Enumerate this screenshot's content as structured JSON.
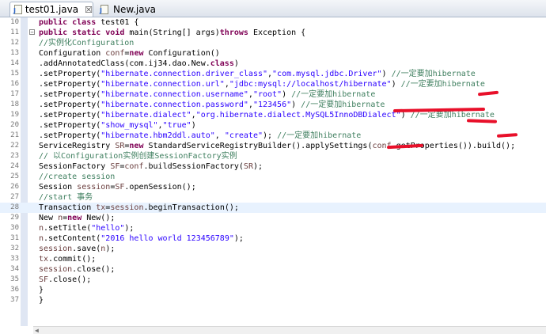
{
  "tabs": [
    {
      "label": "test01.java",
      "close": "☒",
      "active": true
    },
    {
      "label": "New.java",
      "active": false
    }
  ],
  "lines": [
    {
      "num": "10",
      "hl": false,
      "fold": "",
      "segs": [
        [
          "k",
          "public class "
        ],
        [
          "",
          "test01 {"
        ]
      ]
    },
    {
      "num": "11",
      "hl": false,
      "fold": "⊖",
      "segs": [
        [
          "k",
          "public static void "
        ],
        [
          "",
          "main(String[] args)"
        ],
        [
          "k",
          "throws "
        ],
        [
          "",
          "Exception {"
        ]
      ]
    },
    {
      "num": "12",
      "hl": false,
      "fold": "",
      "segs": [
        [
          "c",
          "//实例化Configuration"
        ]
      ]
    },
    {
      "num": "13",
      "hl": false,
      "fold": "",
      "segs": [
        [
          "",
          "Configuration "
        ],
        [
          "v",
          "conf"
        ],
        [
          "",
          "="
        ],
        [
          "k",
          "new "
        ],
        [
          "",
          "Configuration()"
        ]
      ]
    },
    {
      "num": "14",
      "hl": false,
      "fold": "",
      "segs": [
        [
          "",
          ".addAnnotatedClass(com.ij34.dao.New."
        ],
        [
          "k",
          "class"
        ],
        [
          "",
          ")"
        ]
      ]
    },
    {
      "num": "15",
      "hl": false,
      "fold": "",
      "segs": [
        [
          "",
          ".setProperty("
        ],
        [
          "s",
          "\"hibernate.connection.driver_class\""
        ],
        [
          "",
          ","
        ],
        [
          "s",
          "\"com.mysql.jdbc.Driver\""
        ],
        [
          "",
          ") "
        ],
        [
          "c",
          "//一定要加hibernate"
        ]
      ]
    },
    {
      "num": "16",
      "hl": false,
      "fold": "",
      "segs": [
        [
          "",
          ".setProperty("
        ],
        [
          "s",
          "\"hibernate.connection.url\""
        ],
        [
          "",
          ","
        ],
        [
          "s",
          "\"jdbc:mysql://localhost/hibernate\""
        ],
        [
          "",
          ") "
        ],
        [
          "c",
          "//一定要加hibernate"
        ]
      ]
    },
    {
      "num": "17",
      "hl": false,
      "fold": "",
      "segs": [
        [
          "",
          ".setProperty("
        ],
        [
          "s",
          "\"hibernate.connection.username\""
        ],
        [
          "",
          ","
        ],
        [
          "s",
          "\"root\""
        ],
        [
          "",
          ") "
        ],
        [
          "c",
          "//一定要加hibernate"
        ]
      ]
    },
    {
      "num": "18",
      "hl": false,
      "fold": "",
      "segs": [
        [
          "",
          ".setProperty("
        ],
        [
          "s",
          "\"hibernate.connection.password\""
        ],
        [
          "",
          ","
        ],
        [
          "s",
          "\"123456\""
        ],
        [
          "",
          ") "
        ],
        [
          "c",
          "//一定要加hibernate"
        ]
      ]
    },
    {
      "num": "19",
      "hl": false,
      "fold": "",
      "segs": [
        [
          "",
          ".setProperty("
        ],
        [
          "s",
          "\"hibernate.dialect\""
        ],
        [
          "",
          ","
        ],
        [
          "s",
          "\"org.hibernate.dialect.MySQL5InnoDBDialect\""
        ],
        [
          "",
          ") "
        ],
        [
          "c",
          "//一定要加hibernate"
        ]
      ]
    },
    {
      "num": "20",
      "hl": false,
      "fold": "",
      "segs": [
        [
          "",
          ".setProperty("
        ],
        [
          "s",
          "\"show_mysql\""
        ],
        [
          "",
          ","
        ],
        [
          "s",
          "\"true\""
        ],
        [
          "",
          ")"
        ]
      ]
    },
    {
      "num": "21",
      "hl": false,
      "fold": "",
      "segs": [
        [
          "",
          ".setProperty("
        ],
        [
          "s",
          "\"hibernate.hbm2ddl.auto\""
        ],
        [
          "",
          ", "
        ],
        [
          "s",
          "\"create\""
        ],
        [
          "",
          "); "
        ],
        [
          "c",
          "//一定要加hibernate"
        ]
      ]
    },
    {
      "num": "22",
      "hl": false,
      "fold": "",
      "segs": [
        [
          "",
          "ServiceRegistry "
        ],
        [
          "v",
          "SR"
        ],
        [
          "",
          "="
        ],
        [
          "k",
          "new "
        ],
        [
          "",
          "StandardServiceRegistryBuilder().applySettings("
        ],
        [
          "v",
          "conf"
        ],
        [
          "",
          ".getProperties()).build();"
        ]
      ]
    },
    {
      "num": "23",
      "hl": false,
      "fold": "",
      "segs": [
        [
          "c",
          "// 以Configuration实例创建SessionFactory实例"
        ]
      ]
    },
    {
      "num": "24",
      "hl": false,
      "fold": "",
      "segs": [
        [
          "",
          "SessionFactory "
        ],
        [
          "v",
          "SF"
        ],
        [
          "",
          "="
        ],
        [
          "v",
          "conf"
        ],
        [
          "",
          ".buildSessionFactory("
        ],
        [
          "v",
          "SR"
        ],
        [
          "",
          ");"
        ]
      ]
    },
    {
      "num": "25",
      "hl": false,
      "fold": "",
      "segs": [
        [
          "c",
          "//create session"
        ]
      ]
    },
    {
      "num": "26",
      "hl": false,
      "fold": "",
      "segs": [
        [
          "",
          "Session "
        ],
        [
          "v",
          "session"
        ],
        [
          "",
          "="
        ],
        [
          "v",
          "SF"
        ],
        [
          "",
          ".openSession();"
        ]
      ]
    },
    {
      "num": "27",
      "hl": false,
      "fold": "",
      "segs": [
        [
          "c",
          "//start 事务"
        ]
      ]
    },
    {
      "num": "28",
      "hl": true,
      "fold": "",
      "segs": [
        [
          "",
          "Transaction "
        ],
        [
          "v",
          "tx"
        ],
        [
          "",
          "="
        ],
        [
          "v",
          "session"
        ],
        [
          "",
          ".beginTransaction();"
        ]
      ]
    },
    {
      "num": "29",
      "hl": false,
      "fold": "",
      "segs": [
        [
          "",
          "New "
        ],
        [
          "v",
          "n"
        ],
        [
          "",
          "="
        ],
        [
          "k",
          "new "
        ],
        [
          "",
          "New();"
        ]
      ]
    },
    {
      "num": "30",
      "hl": false,
      "fold": "",
      "segs": [
        [
          "v",
          "n"
        ],
        [
          "",
          ".setTitle("
        ],
        [
          "s",
          "\"hello\""
        ],
        [
          "",
          ");"
        ]
      ]
    },
    {
      "num": "31",
      "hl": false,
      "fold": "",
      "segs": [
        [
          "v",
          "n"
        ],
        [
          "",
          ".setContent("
        ],
        [
          "s",
          "\"2016 hello world 123456789\""
        ],
        [
          "",
          ");"
        ]
      ]
    },
    {
      "num": "32",
      "hl": false,
      "fold": "",
      "segs": [
        [
          "v",
          "session"
        ],
        [
          "",
          ".save("
        ],
        [
          "v",
          "n"
        ],
        [
          "",
          ");"
        ]
      ]
    },
    {
      "num": "33",
      "hl": false,
      "fold": "",
      "segs": [
        [
          "v",
          "tx"
        ],
        [
          "",
          ".commit();"
        ]
      ]
    },
    {
      "num": "34",
      "hl": false,
      "fold": "",
      "segs": [
        [
          "v",
          "session"
        ],
        [
          "",
          ".close();"
        ]
      ]
    },
    {
      "num": "35",
      "hl": false,
      "fold": "",
      "segs": [
        [
          "v",
          "SF"
        ],
        [
          "",
          ".close();"
        ]
      ]
    },
    {
      "num": "36",
      "hl": false,
      "fold": "",
      "segs": [
        [
          "",
          "}"
        ]
      ]
    },
    {
      "num": "37",
      "hl": false,
      "fold": "",
      "segs": [
        [
          "",
          "}"
        ]
      ]
    }
  ],
  "colors": {
    "keyword": "#7f0055",
    "string": "#2a00ff",
    "comment": "#3f7f5f",
    "variable": "#6a3e3e",
    "annotation_marks": "#e8102a"
  }
}
